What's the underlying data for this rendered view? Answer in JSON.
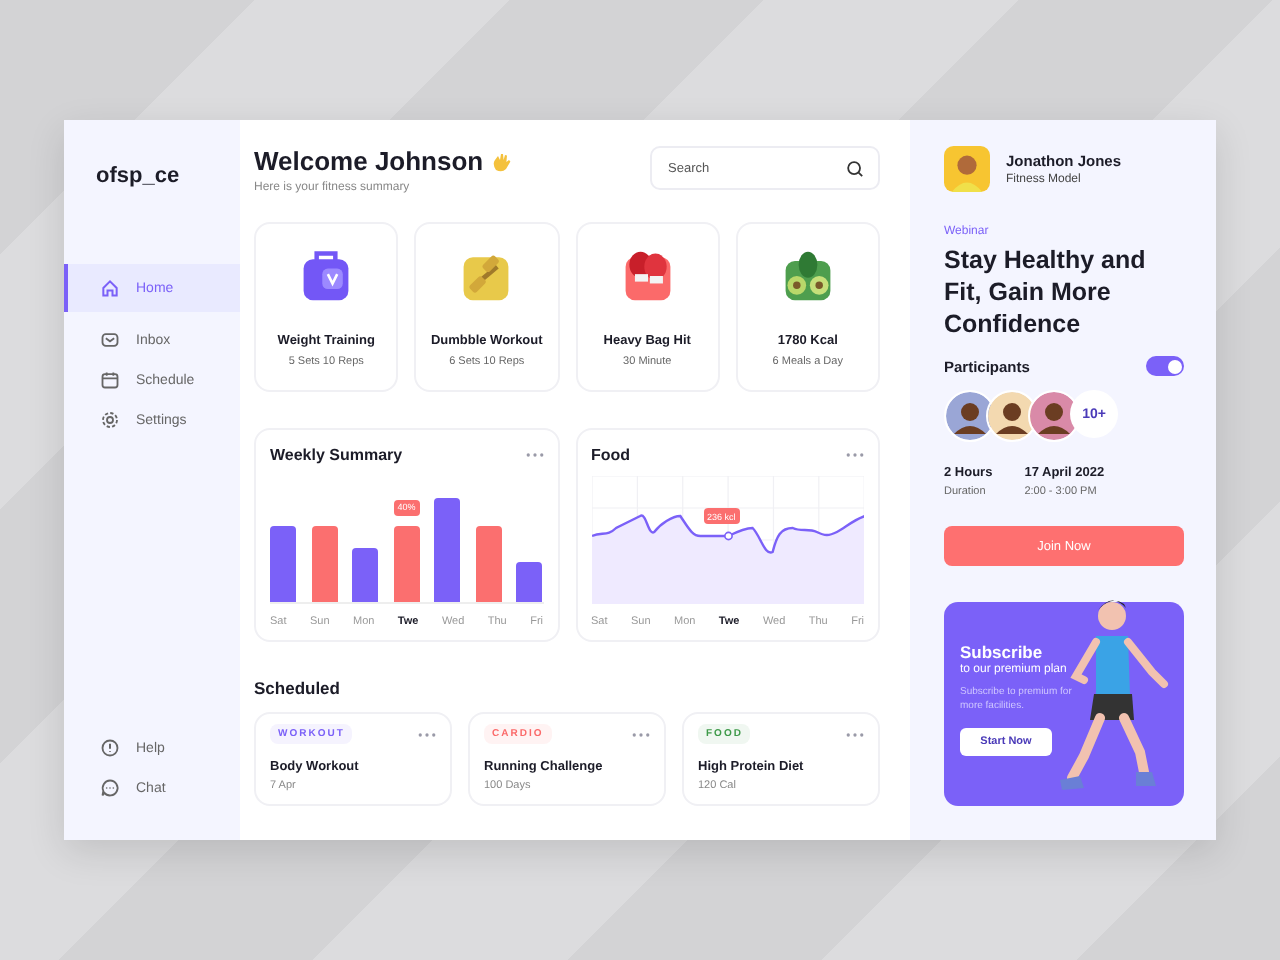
{
  "sidebar": {
    "logo": "ofsp_ce",
    "nav": [
      {
        "kind": "home",
        "label": "Home",
        "selected": true
      },
      {
        "kind": "inbox",
        "label": "Inbox",
        "selected": false
      },
      {
        "kind": "schedule",
        "label": "Schedule",
        "selected": false
      },
      {
        "kind": "settings",
        "label": "Settings",
        "selected": false
      }
    ],
    "footer": [
      {
        "kind": "help",
        "label": "Help"
      },
      {
        "kind": "chat",
        "label": "Chat"
      }
    ]
  },
  "header": {
    "title": "Welcome Johnson",
    "subtitle": "Here is your fitness summary"
  },
  "search": {
    "placeholder": "Search"
  },
  "activities": [
    {
      "kind": "bag",
      "title": "Weight Training",
      "detail": "5 Sets 10 Reps",
      "color": "#7357f6"
    },
    {
      "kind": "dumbbell",
      "title": "Dumbble Workout",
      "detail": "6 Sets 10 Reps",
      "color": "#e8c94a"
    },
    {
      "kind": "gloves",
      "title": "Heavy Bag Hit",
      "detail": "30 Minute",
      "color": "#fb6a6a"
    },
    {
      "kind": "food",
      "title": "1780 Kcal",
      "detail": "6 Meals a Day",
      "color": "#4e9e4e"
    }
  ],
  "weekly_summary": {
    "title": "Weekly Summary",
    "highlight": "40%",
    "days": [
      {
        "label": "Sat",
        "selected": false
      },
      {
        "label": "Sun",
        "selected": false
      },
      {
        "label": "Mon",
        "selected": false
      },
      {
        "label": "Twe",
        "selected": true
      },
      {
        "label": "Wed",
        "selected": false
      },
      {
        "label": "Thu",
        "selected": false
      },
      {
        "label": "Fri",
        "selected": false
      }
    ]
  },
  "food": {
    "title": "Food",
    "tooltip": "236 kcl",
    "days": [
      {
        "label": "Sat",
        "selected": false
      },
      {
        "label": "Sun",
        "selected": false
      },
      {
        "label": "Mon",
        "selected": false
      },
      {
        "label": "Twe",
        "selected": true
      },
      {
        "label": "Wed",
        "selected": false
      },
      {
        "label": "Thu",
        "selected": false
      },
      {
        "label": "Fri",
        "selected": false
      }
    ]
  },
  "scheduled": {
    "title": "Scheduled",
    "items": [
      {
        "tag": "WORKOUT",
        "color": "#7b61f8",
        "title": "Body Workout",
        "detail": "7 Apr"
      },
      {
        "tag": "CARDIO",
        "color": "#fb6a6a",
        "title": "Running Challenge",
        "detail": "100 Days"
      },
      {
        "tag": "FOOD",
        "color": "#3f9a4a",
        "title": "High Protein Diet",
        "detail": "120 Cal"
      }
    ]
  },
  "profile": {
    "name": "Jonathon Jones",
    "role": "Fitness Model"
  },
  "webinar": {
    "label": "Webinar",
    "title": "Stay Healthy and Fit, Gain More Confidence",
    "participants_label": "Participants",
    "participants_on": true,
    "participants": [
      {
        "color": "#9aa6d6"
      },
      {
        "color": "#f3d9b0"
      },
      {
        "color": "#d98aa8"
      }
    ],
    "more": "10+",
    "duration": "2 Hours",
    "duration_label": "Duration",
    "date": "17 April 2022",
    "time": "2:00 - 3:00 PM",
    "button": "Join Now"
  },
  "promo": {
    "title": "Subscribe",
    "subtitle": "to our premium plan",
    "text": "Subscribe to premium for more facilities.",
    "button": "Start Now"
  }
}
